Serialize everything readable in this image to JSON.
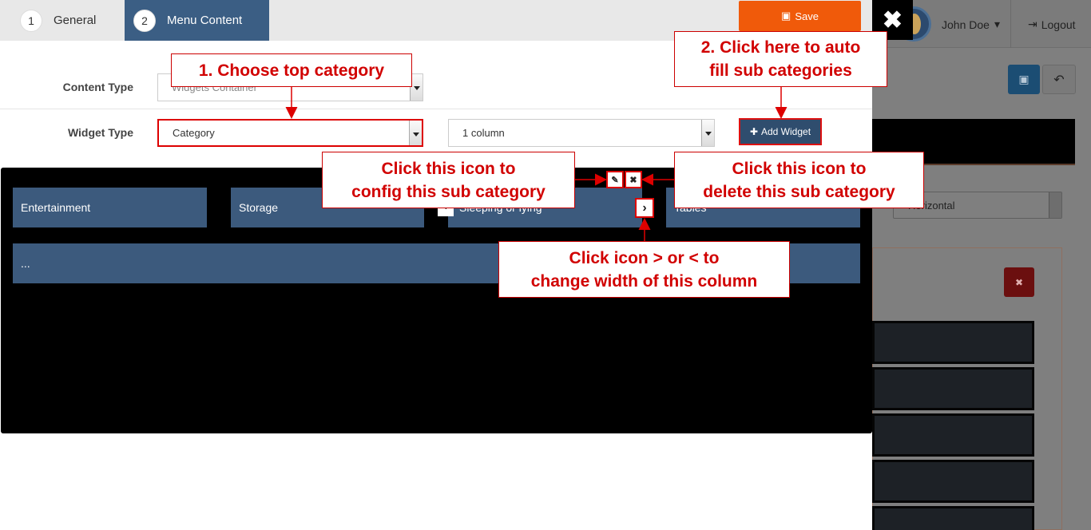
{
  "wizard": {
    "steps": [
      {
        "num": "1",
        "label": "General"
      },
      {
        "num": "2",
        "label": "Menu Content"
      }
    ],
    "save_label": "Save",
    "close_glyph": "✖"
  },
  "form": {
    "content_type_label": "Content Type",
    "content_type_value": "Widgets Container",
    "widget_type_label": "Widget Type",
    "widget_type_value": "Category",
    "columns_value": "1 column",
    "add_widget_label": "Add Widget"
  },
  "canvas": {
    "row1": [
      "Entertainment",
      "Storage",
      "Sleeping or lying",
      "Tables"
    ],
    "row2": "..."
  },
  "callouts": {
    "choose_top": "1. Choose top category",
    "auto_fill_line1": "2. Click here to auto",
    "auto_fill_line2": "fill sub categories",
    "config_line1": "Click this icon to",
    "config_line2": "config this sub category",
    "delete_line1": "Click this icon to",
    "delete_line2": "delete this sub category",
    "width_line1": "Click icon > or < to",
    "width_line2": "change width of this column"
  },
  "background": {
    "user_name": "John Doe",
    "logout_label": "Logout",
    "layout_select": "Horizontal"
  },
  "colors": {
    "accent_orange": "#f05a0a",
    "step_active": "#3b5e84",
    "cell": "#3c5a7d",
    "annotation_red": "#d10000"
  }
}
